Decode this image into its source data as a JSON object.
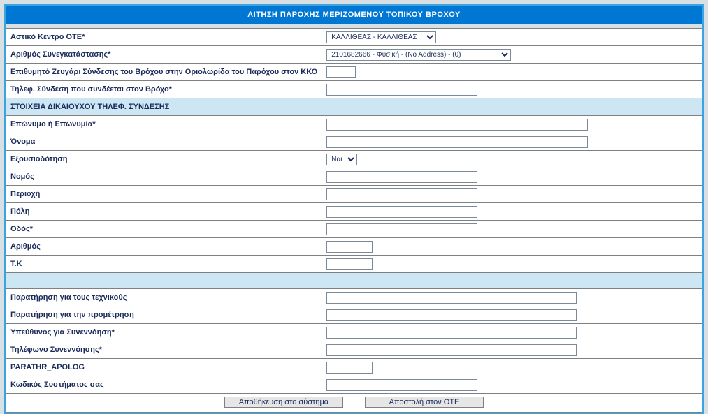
{
  "title": "ΑΙΤΗΣΗ ΠΑΡΟΧΗΣ ΜΕΡΙΖΟΜΕΝΟΥ ΤΟΠΙΚΟΥ ΒΡΟΧΟΥ",
  "labels": {
    "center": "Αστικό Κέντρο ΟΤΕ*",
    "conum": "Αριθμός Συνεγκατάστασης*",
    "pair": "Επιθυμητό Ζευγάρι Σύνδεσης του Βρόχου στην Οριολωρίδα του Παρόχου στον ΚΚΟ",
    "phoneconn": "Τηλεφ. Σύνδεση που συνδέεται στον Βρόχο*",
    "section_holder": "ΣΤΟΙΧΕΙΑ ΔΙΚΑΙΟΥΧΟΥ ΤΗΛΕΦ. ΣΥΝΔΕΣΗΣ",
    "surname": "Επώνυμο ή Επωνυμία*",
    "name": "Όνομα",
    "auth": "Εξουσιοδότηση",
    "prefecture": "Νομός",
    "area": "Περιοχή",
    "city": "Πόλη",
    "street": "Οδός*",
    "number": "Αριθμός",
    "zip": "Τ.Κ",
    "note_tech": "Παρατήρηση για τους τεχνικούς",
    "note_pre": "Παρατήρηση για την προμέτρηση",
    "contact_person": "Υπεύθυνος για Συνεννόηση*",
    "contact_phone": "Τηλέφωνο Συνεννόησης*",
    "parathr": "PARATHR_APOLOG",
    "syscode": "Κωδικός Συστήματος σας"
  },
  "values": {
    "center_selected": "ΚΑΛΛΙΘΕΑΣ - ΚΑΛΛΙΘΕΑΣ",
    "conum_selected": "2101682666 - Φυσική - (No Address) - (0)",
    "auth_selected": "Ναι"
  },
  "buttons": {
    "save": "Αποθήκευση στο σύστημα",
    "send": "Αποστολή στον ΟΤΕ"
  }
}
